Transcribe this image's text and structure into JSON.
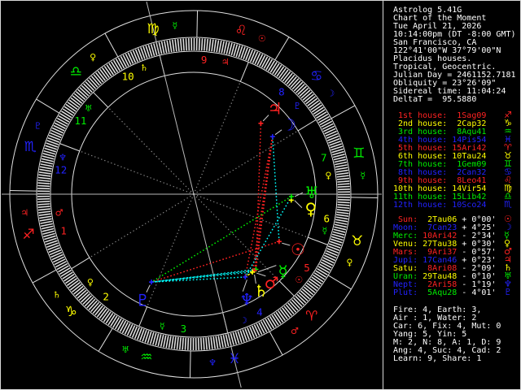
{
  "app": {
    "title_lines": [
      "Astrolog 5.41G",
      "Chart of the Moment",
      "Tue April 21, 2026",
      "10:14:00pm (DT -8:00 GMT)",
      "San Francisco, CA",
      "122°41'00\"W 37°79'00\"N",
      "Placidus houses.",
      "Tropical, Geocentric.",
      "Julian Day = 2461152.7181",
      "Obliquity = 23°26'09\"",
      "Sidereal time: 11:04:24",
      "DeltaT =  95.5880"
    ]
  },
  "palette": {
    "fire": "#ff2222",
    "earth": "#ffff00",
    "air": "#00ee00",
    "water": "#2222ff",
    "white": "#ffffff",
    "circle": "#e0e0e0",
    "axis": "#b8b8b8",
    "cusp_dotted": "#8a8a8a",
    "pointer": "#cccccc",
    "aspect": {
      "conjunction": "#ffff00",
      "square": "#ff2222",
      "trine": "#00ee00",
      "sextile": "#00ffff"
    },
    "planet": {
      "Sun": "#ff2222",
      "Moon": "#2222ff",
      "Mercury": "#00ee00",
      "Venus": "#ffff00",
      "Mars": "#ff2222",
      "Jupiter": "#ff2222",
      "Saturn": "#ffff00",
      "Uranus": "#00ee00",
      "Neptune": "#2222ff",
      "Pluto": "#2222ff"
    }
  },
  "houses_table": [
    {
      "label": " 1st house:  1Sag09",
      "glyph": "♐",
      "element": "fire"
    },
    {
      "label": " 2nd house:  2Cap32",
      "glyph": "♑",
      "element": "earth"
    },
    {
      "label": " 3rd house:  8Aqu41",
      "glyph": "♒",
      "element": "air"
    },
    {
      "label": " 4th house: 14Pis54",
      "glyph": "♓",
      "element": "water"
    },
    {
      "label": " 5th house: 15Ari42",
      "glyph": "♈",
      "element": "fire"
    },
    {
      "label": " 6th house: 10Tau24",
      "glyph": "♉",
      "element": "earth"
    },
    {
      "label": " 7th house:  1Gem09",
      "glyph": "♊",
      "element": "air"
    },
    {
      "label": " 8th house:  2Can32",
      "glyph": "♋",
      "element": "water"
    },
    {
      "label": " 9th house:  8Leo41",
      "glyph": "♌",
      "element": "fire"
    },
    {
      "label": "10th house: 14Vir54",
      "glyph": "♍",
      "element": "earth"
    },
    {
      "label": "11th house: 15Lib42",
      "glyph": "♎",
      "element": "air"
    },
    {
      "label": "12th house: 10Sco24",
      "glyph": "♏",
      "element": "water"
    }
  ],
  "planets_table": [
    {
      "label": " Sun:",
      "value": "  2Tau06",
      "velocity": " + 0°00'",
      "glyph": "☉",
      "planet": "Sun",
      "value_element": "earth"
    },
    {
      "label": "Moon:",
      "value": "  7Can23",
      "velocity": " + 4°25'",
      "glyph": "☽",
      "planet": "Moon",
      "value_element": "water"
    },
    {
      "label": "Merc:",
      "value": " 10Ari42",
      "velocity": " - 2°34'",
      "glyph": "☿",
      "planet": "Mercury",
      "value_element": "fire"
    },
    {
      "label": "Venu:",
      "value": " 27Tau38",
      "velocity": " + 0°30'",
      "glyph": "♀",
      "planet": "Venus",
      "value_element": "earth"
    },
    {
      "label": "Mars:",
      "value": "  9Ari37",
      "velocity": " - 0°57'",
      "glyph": "♂",
      "planet": "Mars",
      "value_element": "fire"
    },
    {
      "label": "Jupi:",
      "value": " 17Can46",
      "velocity": " + 0°23'",
      "glyph": "♃",
      "planet": "Jupiter",
      "value_element": "water",
      "label_color_override": "#2222ff"
    },
    {
      "label": "Satu:",
      "value": "  8Ari08",
      "velocity": " - 2°09'",
      "glyph": "♄",
      "planet": "Saturn",
      "value_element": "fire"
    },
    {
      "label": "Uran:",
      "value": " 29Tau48",
      "velocity": " - 0°10'",
      "glyph": "♅",
      "planet": "Uranus",
      "value_element": "earth"
    },
    {
      "label": "Nept:",
      "value": "  2Ari58",
      "velocity": " - 1°19'",
      "glyph": "♆",
      "planet": "Neptune",
      "value_element": "fire"
    },
    {
      "label": "Plut:",
      "value": "  5Aqu28",
      "velocity": " - 4°01'",
      "glyph": "♇",
      "planet": "Pluto",
      "value_element": "air"
    }
  ],
  "stats_lines": [
    "Fire: 4, Earth: 3,",
    "Air : 1, Water: 2",
    "Car: 6, Fix: 4, Mut: 0",
    "Yang: 5, Yin: 5",
    "M: 2, N: 8, A: 1, D: 9",
    "Ang: 4, Suc: 4, Cad: 2",
    "Learn: 9, Share: 1"
  ],
  "chart_data": {
    "type": "astrology-wheel",
    "ascendant_lon": 241.15,
    "house_cusps_lon": [
      241.15,
      272.53,
      308.68,
      344.9,
      15.7,
      40.4,
      61.15,
      92.53,
      128.68,
      164.9,
      195.7,
      220.4
    ],
    "house_ruler_glyphs": [
      "♂",
      "♀",
      "☿",
      "☽",
      "☉",
      "☿",
      "♀",
      "♇",
      "♃",
      "♄",
      "♅",
      "♆"
    ],
    "house_ruler_planets": [
      "Mars",
      "Venus",
      "Mercury",
      "Moon",
      "Sun",
      "Mercury",
      "Venus",
      "Pluto",
      "Jupiter",
      "Saturn",
      "Uranus",
      "Neptune"
    ],
    "signs": [
      {
        "name": "Aries",
        "glyph": "♈",
        "element": "fire",
        "ruler_glyph": "♂",
        "ruler": "Mars"
      },
      {
        "name": "Taurus",
        "glyph": "♉",
        "element": "earth",
        "ruler_glyph": "♀",
        "ruler": "Venus"
      },
      {
        "name": "Gemini",
        "glyph": "♊",
        "element": "air",
        "ruler_glyph": "☿",
        "ruler": "Mercury"
      },
      {
        "name": "Cancer",
        "glyph": "♋",
        "element": "water",
        "ruler_glyph": "☽",
        "ruler": "Moon"
      },
      {
        "name": "Leo",
        "glyph": "♌",
        "element": "fire",
        "ruler_glyph": "☉",
        "ruler": "Sun"
      },
      {
        "name": "Virgo",
        "glyph": "♍",
        "element": "earth",
        "ruler_glyph": "☿",
        "ruler": "Mercury"
      },
      {
        "name": "Libra",
        "glyph": "♎",
        "element": "air",
        "ruler_glyph": "♀",
        "ruler": "Venus"
      },
      {
        "name": "Scorpio",
        "glyph": "♏",
        "element": "water",
        "ruler_glyph": "♇",
        "ruler": "Pluto"
      },
      {
        "name": "Sagittarius",
        "glyph": "♐",
        "element": "fire",
        "ruler_glyph": "♃",
        "ruler": "Jupiter"
      },
      {
        "name": "Capricorn",
        "glyph": "♑",
        "element": "earth",
        "ruler_glyph": "♄",
        "ruler": "Saturn"
      },
      {
        "name": "Aquarius",
        "glyph": "♒",
        "element": "air",
        "ruler_glyph": "♅",
        "ruler": "Uranus"
      },
      {
        "name": "Pisces",
        "glyph": "♓",
        "element": "water",
        "ruler_glyph": "♆",
        "ruler": "Neptune"
      }
    ],
    "planets": [
      {
        "name": "Sun",
        "glyph": "☉",
        "lon": 32.1,
        "display_lon": 33.1
      },
      {
        "name": "Moon",
        "glyph": "☽",
        "lon": 97.38,
        "display_lon": 97.38
      },
      {
        "name": "Mercury",
        "glyph": "☿",
        "lon": 10.7,
        "display_lon": 20.3
      },
      {
        "name": "Venus",
        "glyph": "♀",
        "lon": 57.63,
        "display_lon": 54.0
      },
      {
        "name": "Mars",
        "glyph": "♂",
        "lon": 9.62,
        "display_lon": 12.4
      },
      {
        "name": "Jupiter",
        "glyph": "♃",
        "lon": 107.77,
        "display_lon": 107.77
      },
      {
        "name": "Saturn",
        "glyph": "♄",
        "lon": 8.13,
        "display_lon": 5.9
      },
      {
        "name": "Uranus",
        "glyph": "♅",
        "lon": 59.8,
        "display_lon": 62.0
      },
      {
        "name": "Neptune",
        "glyph": "♆",
        "lon": 2.97,
        "display_lon": 357.9
      },
      {
        "name": "Pluto",
        "glyph": "♇",
        "lon": 305.47,
        "display_lon": 305.47
      }
    ],
    "aspects": [
      {
        "a": "Mercury",
        "b": "Mars",
        "type": "conjunction"
      },
      {
        "a": "Mercury",
        "b": "Saturn",
        "type": "conjunction"
      },
      {
        "a": "Mars",
        "b": "Saturn",
        "type": "conjunction"
      },
      {
        "a": "Mars",
        "b": "Neptune",
        "type": "conjunction"
      },
      {
        "a": "Saturn",
        "b": "Neptune",
        "type": "conjunction"
      },
      {
        "a": "Venus",
        "b": "Uranus",
        "type": "conjunction"
      },
      {
        "a": "Sun",
        "b": "Pluto",
        "type": "square"
      },
      {
        "a": "Moon",
        "b": "Mercury",
        "type": "square"
      },
      {
        "a": "Moon",
        "b": "Mars",
        "type": "square"
      },
      {
        "a": "Moon",
        "b": "Saturn",
        "type": "square"
      },
      {
        "a": "Moon",
        "b": "Neptune",
        "type": "square"
      },
      {
        "a": "Mercury",
        "b": "Jupiter",
        "type": "square"
      },
      {
        "a": "Uranus",
        "b": "Pluto",
        "type": "trine"
      },
      {
        "a": "Sun",
        "b": "Moon",
        "type": "sextile"
      },
      {
        "a": "Mercury",
        "b": "Pluto",
        "type": "sextile"
      },
      {
        "a": "Mars",
        "b": "Pluto",
        "type": "sextile"
      },
      {
        "a": "Saturn",
        "b": "Pluto",
        "type": "sextile"
      },
      {
        "a": "Neptune",
        "b": "Pluto",
        "type": "sextile"
      },
      {
        "a": "Uranus",
        "b": "Neptune",
        "type": "sextile"
      }
    ],
    "geometry": {
      "center": [
        238,
        239
      ],
      "r_outer": 226,
      "r_sign_inner": 193,
      "r_tick_inner": 176,
      "r_inner": 150,
      "r_sign_glyph": 209,
      "r_house_label": 166,
      "r_planet_glyph": 145,
      "r_planet_dot": 120
    }
  }
}
